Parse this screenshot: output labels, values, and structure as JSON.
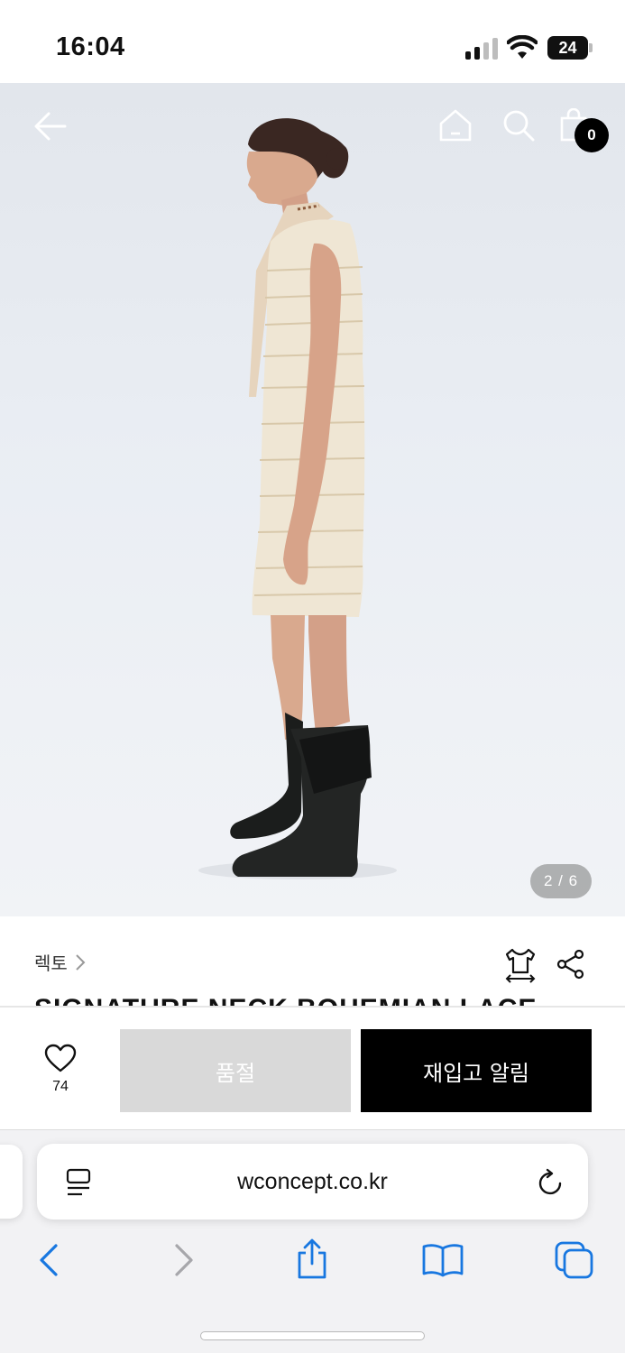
{
  "status_bar": {
    "time": "16:04",
    "battery": "24"
  },
  "gallery": {
    "cart_count": "0",
    "page_indicator": "2 / 6"
  },
  "product": {
    "brand": "렉토",
    "title_partial": "SIGNATURE NECK BOHEMIAN LACE"
  },
  "actions": {
    "like_count": "74",
    "soldout_label": "품절",
    "restock_label": "재입고 알림"
  },
  "browser": {
    "url": "wconcept.co.kr"
  },
  "colors": {
    "accent_ios": "#1877e0",
    "black": "#000000",
    "soldout_bg": "#d9d9d9"
  }
}
